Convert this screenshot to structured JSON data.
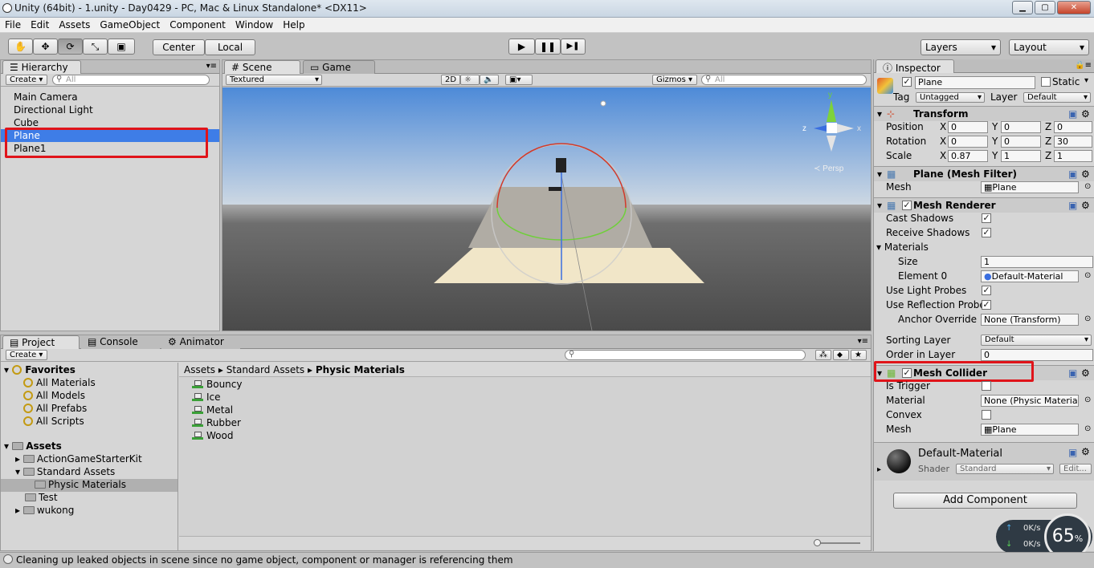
{
  "window": {
    "title": "Unity (64bit) - 1.unity - Day0429 - PC, Mac & Linux Standalone* <DX11>",
    "min_label": "▁",
    "max_label": "▢",
    "close_label": "✕"
  },
  "menu": [
    "File",
    "Edit",
    "Assets",
    "GameObject",
    "Component",
    "Window",
    "Help"
  ],
  "toolbar": {
    "tools": [
      "hand-tool",
      "move-tool",
      "rotate-tool",
      "scale-tool",
      "rect-tool"
    ],
    "pivot": "Center",
    "space": "Local",
    "play": "▶",
    "pause": "❚❚",
    "step": "▶❚",
    "layers": "Layers",
    "layout": "Layout"
  },
  "hierarchy": {
    "tab": "Hierarchy",
    "create": "Create ▾",
    "search_placeholder": "All",
    "items": [
      "Main Camera",
      "Directional Light",
      "Cube",
      "Plane",
      "Plane1"
    ],
    "selected_index": 3
  },
  "scene": {
    "tabs": [
      "Scene",
      "Game"
    ],
    "shading": "Textured",
    "mode2d": "2D",
    "gizmos": "Gizmos ▾",
    "search_placeholder": "All",
    "gizmo_labels": {
      "y": "y",
      "z": "z",
      "x": "x",
      "persp": "≺ Persp"
    }
  },
  "project": {
    "tabs": [
      "Project",
      "Console",
      "Animator"
    ],
    "create": "Create ▾",
    "favorites_label": "Favorites",
    "favorites": [
      "All Materials",
      "All Models",
      "All Prefabs",
      "All Scripts"
    ],
    "assets_label": "Assets",
    "folders": [
      "ActionGameStarterKit",
      "Standard Assets",
      "Physic Materials",
      "Test",
      "wukong"
    ],
    "breadcrumb": [
      "Assets",
      "Standard Assets",
      "Physic Materials"
    ],
    "files": [
      "Bouncy",
      "Ice",
      "Metal",
      "Rubber",
      "Wood"
    ]
  },
  "inspector": {
    "tab": "Inspector",
    "object_name": "Plane",
    "static_label": "Static",
    "tag_label": "Tag",
    "tag_value": "Untagged",
    "layer_label": "Layer",
    "layer_value": "Default",
    "transform": {
      "title": "Transform",
      "position_label": "Position",
      "rotation_label": "Rotation",
      "scale_label": "Scale",
      "position": [
        "0",
        "0",
        "0"
      ],
      "rotation": [
        "0",
        "0",
        "30"
      ],
      "scale": [
        "0.87",
        "1",
        "1"
      ],
      "x": "X",
      "y": "Y",
      "z": "Z"
    },
    "mesh_filter": {
      "title": "Plane (Mesh Filter)",
      "mesh_label": "Mesh",
      "mesh_value": "Plane"
    },
    "mesh_renderer": {
      "title": "Mesh Renderer",
      "cast_shadows": "Cast Shadows",
      "receive_shadows": "Receive Shadows",
      "materials": "Materials",
      "size_label": "Size",
      "size_value": "1",
      "element0_label": "Element 0",
      "element0_value": "Default-Material",
      "light_probes": "Use Light Probes",
      "reflection_probes": "Use Reflection Probe",
      "anchor_label": "Anchor Override",
      "anchor_value": "None (Transform)",
      "sorting_label": "Sorting Layer",
      "sorting_value": "Default",
      "order_label": "Order in Layer",
      "order_value": "0"
    },
    "mesh_collider": {
      "title": "Mesh Collider",
      "is_trigger": "Is Trigger",
      "material_label": "Material",
      "material_value": "None (Physic Materia",
      "convex": "Convex",
      "mesh_label": "Mesh",
      "mesh_value": "Plane"
    },
    "material": {
      "name": "Default-Material",
      "shader_label": "Shader",
      "shader_value": "Standard",
      "edit": "Edit..."
    },
    "add_component": "Add Component"
  },
  "netmon": {
    "up": "0K/s",
    "down": "0K/s",
    "percent": "65",
    "pct_sign": "%"
  },
  "status": "Cleaning up leaked objects in scene since no game object, component or manager is referencing them",
  "colors": {
    "selection": "#3e7de7",
    "highlight": "#e0141a",
    "sky_top": "#4d8ad8",
    "ground": "#565656"
  }
}
